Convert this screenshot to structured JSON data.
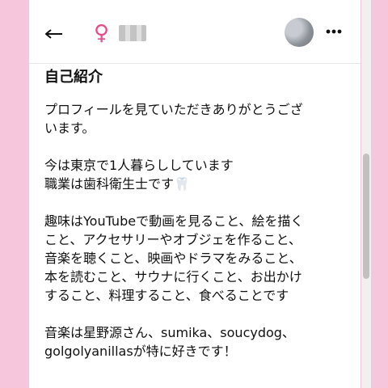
{
  "header": {
    "back_icon": "arrow-left-icon",
    "gender_symbol": "♀",
    "gender_color": "#e84b8a",
    "more_icon": "more-horizontal-icon"
  },
  "profile": {
    "section_title": "自己紹介",
    "intro_text": "プロフィールを見ていただきありがとうござ\nいます。\n\n今は東京で1人暮らししています\n職業は歯科衛生士です🦷\n\n趣味はYouTubeで動画を見ること、絵を描く\nこと、アクセサリーやオブジェを作ること、\n音楽を聴くこと、映画やドラマをみること、\n本を読むこと、サウナに行くこと、お出かけ\nすること、料理すること、食べることです\n\n音楽は星野源さん、sumika、soucydog、\ngolgolyanillasが特に好きです！"
  },
  "colors": {
    "background": "#f6c6dc",
    "accent": "#e84b8a"
  }
}
